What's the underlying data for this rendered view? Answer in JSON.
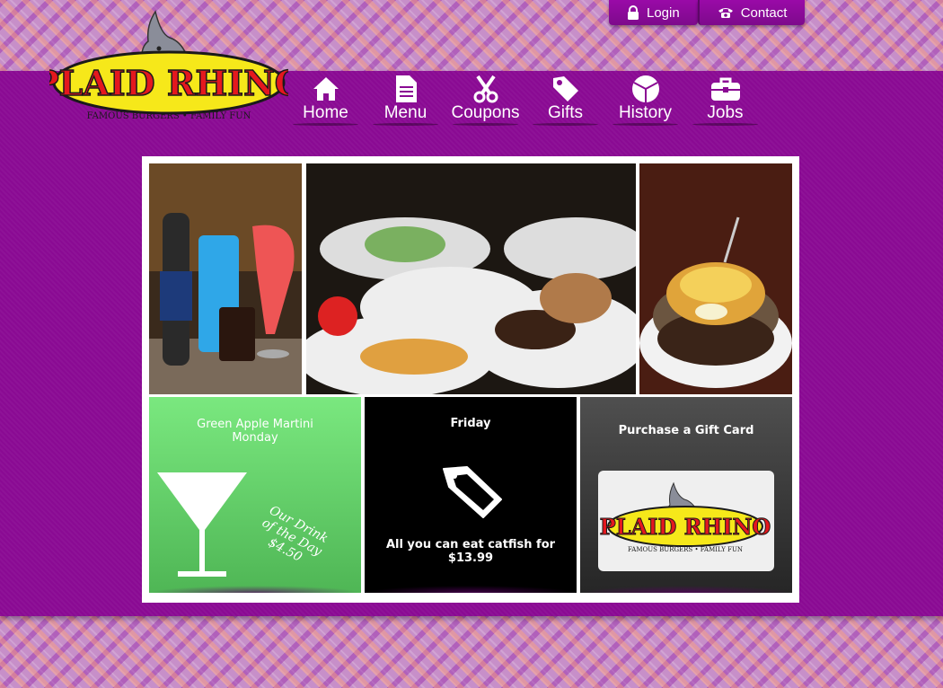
{
  "header": {
    "login_label": "Login",
    "contact_label": "Contact"
  },
  "logo": {
    "brand": "PLAID RHINO",
    "tagline": "FAMOUS BURGERS • FAMILY FUN"
  },
  "nav": [
    {
      "label": "Home",
      "icon": "home-icon"
    },
    {
      "label": "Menu",
      "icon": "document-icon"
    },
    {
      "label": "Coupons",
      "icon": "scissors-icon"
    },
    {
      "label": "Gifts",
      "icon": "tag-icon"
    },
    {
      "label": "History",
      "icon": "cube-icon"
    },
    {
      "label": "Jobs",
      "icon": "toolbox-icon"
    }
  ],
  "promos": {
    "monday": {
      "title": "Green Apple Martini Monday",
      "script": [
        "Our Drink",
        "of the Day",
        "$4.50"
      ]
    },
    "friday": {
      "title": "Friday",
      "text": "All you can eat catfish for $13.99"
    },
    "gift": {
      "title": "Purchase a Gift Card"
    }
  },
  "colors": {
    "nav_band": "#8a0a93",
    "promo_green": "#6cd872",
    "promo_black": "#000000",
    "promo_grey": "#3a3a3a"
  }
}
